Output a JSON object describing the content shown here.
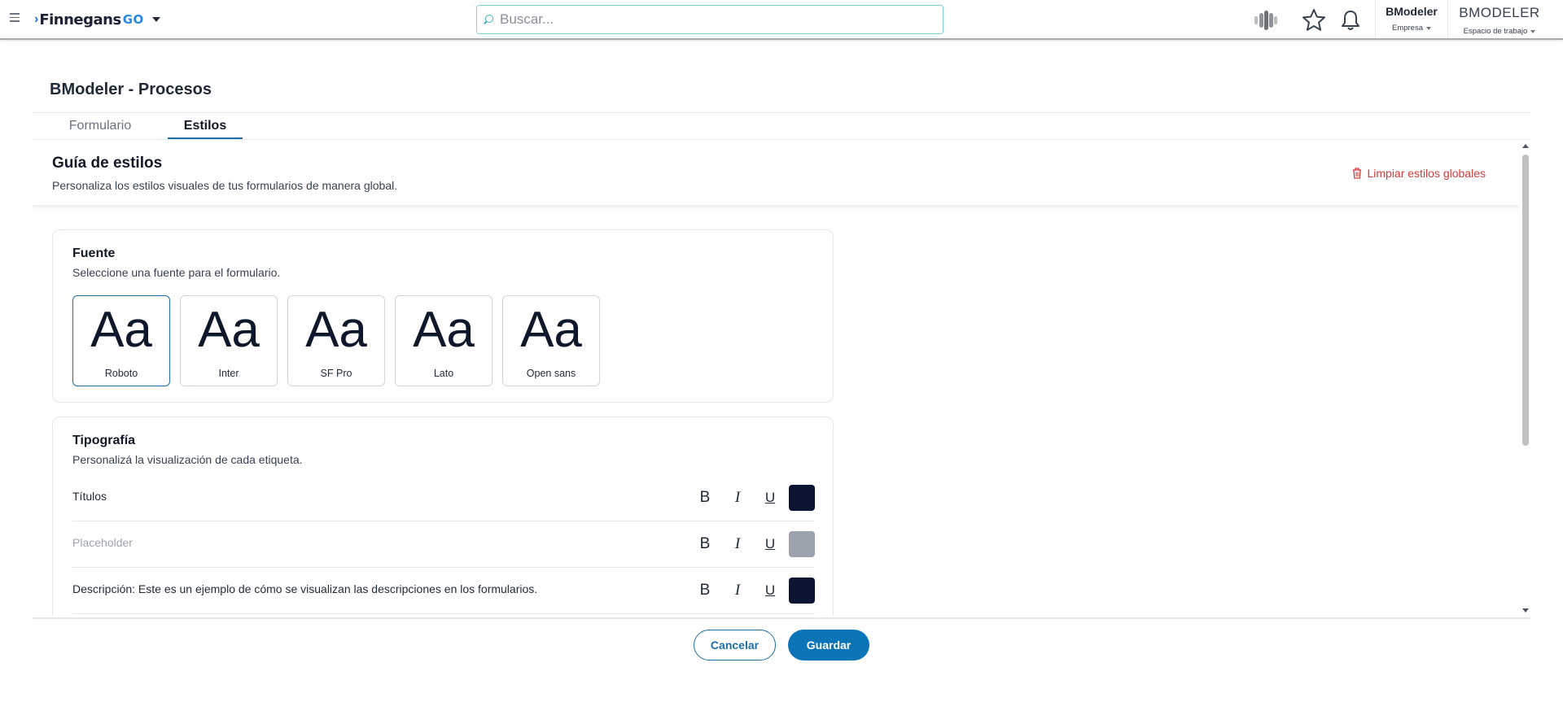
{
  "header": {
    "logo_text": "Finnegans",
    "logo_suffix": "GO",
    "search_placeholder": "Buscar...",
    "company_name": "BModeler",
    "company_label": "Empresa",
    "workspace_name": "BMODELER",
    "workspace_label": "Espacio de trabajo"
  },
  "page": {
    "title": "BModeler - Procesos",
    "tabs": [
      {
        "label": "Formulario",
        "active": false
      },
      {
        "label": "Estilos",
        "active": true
      }
    ]
  },
  "guide": {
    "title": "Guía de estilos",
    "subtitle": "Personaliza los estilos visuales de tus formularios de manera global.",
    "clear_label": "Limpiar estilos globales"
  },
  "font_card": {
    "title": "Fuente",
    "subtitle": "Seleccione una fuente para el formulario.",
    "sample": "Aa",
    "options": [
      {
        "label": "Roboto",
        "selected": true
      },
      {
        "label": "Inter",
        "selected": false
      },
      {
        "label": "SF Pro",
        "selected": false
      },
      {
        "label": "Lato",
        "selected": false
      },
      {
        "label": "Open sans",
        "selected": false
      }
    ]
  },
  "typography_card": {
    "title": "Tipografía",
    "subtitle": "Personalizá la visualización de cada etiqueta.",
    "format_labels": {
      "bold": "B",
      "italic": "I",
      "underline": "U"
    },
    "rows": [
      {
        "label": "Títulos",
        "color": "#0b1433"
      },
      {
        "label": "Placeholder",
        "color": "#9ca3af"
      },
      {
        "label": "Descripción: Este es un ejemplo de cómo se visualizan las descripciones en los formularios.",
        "color": "#0b1433"
      }
    ]
  },
  "footer": {
    "cancel_label": "Cancelar",
    "save_label": "Guardar"
  },
  "colors": {
    "accent": "#0c75b8",
    "danger": "#d23b3b",
    "search_border": "#7fd3e0"
  }
}
